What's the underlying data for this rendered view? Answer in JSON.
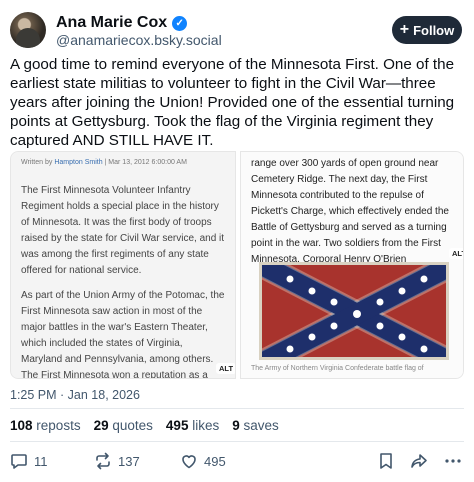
{
  "author": {
    "display_name": "Ana Marie Cox",
    "handle": "@anamariecox.bsky.social",
    "verified_glyph": "✓"
  },
  "follow_button": {
    "label": "Follow",
    "icon": "+"
  },
  "post": {
    "text": "A good time to remind everyone of the Minnesota First. One of the earliest state militias to volunteer to fight in the Civil War—three years after joining the Union! Provided one of the essential turning points at Gettysburg. Took the flag of the Virginia regiment they captured AND STILL HAVE IT.",
    "timestamp": "1:25 PM · Jan 18, 2026"
  },
  "embed": {
    "left": {
      "byline_prefix": "Written by",
      "byline_author": "Hampton Smith",
      "byline_suffix": "| Mar 13, 2012 6:00:00 AM",
      "paragraph1": "The First Minnesota Volunteer Infantry Regiment holds a special place in the history of Minnesota. It was the first body of troops raised by the state for Civil War service, and it was among the first regiments of any state offered for national service.",
      "paragraph2": "As part of the Union Army of the Potomac, the First Minnesota saw action in most of the major battles in the war's Eastern Theater, which included the states of Virginia, Maryland and Pennsylvania, among others. The First Minnesota won a reputation as a",
      "alt_label": "ALT"
    },
    "right": {
      "text": "range over 300 yards of open ground near Cemetery Ridge. The next day, the First Minnesota contributed to the repulse of Pickett's Charge, which effectively ended the Battle of Gettysburg and served as a turning point in the war. Two soldiers from the First Minnesota, Corporal Henry O'Brien",
      "caption": "The Army of Northern Virginia Confederate battle flag of",
      "alt_label": "ALT",
      "flag_colors": {
        "field": "#a8332d",
        "cross": "#1e2f6b",
        "border": "#d9d2c2",
        "stars": "#ffffff"
      }
    }
  },
  "stats": {
    "reposts_count": "108",
    "reposts_label": "reposts",
    "quotes_count": "29",
    "quotes_label": "quotes",
    "likes_count": "495",
    "likes_label": "likes",
    "saves_count": "9",
    "saves_label": "saves"
  },
  "actions": {
    "reply_count": "11",
    "repost_count": "137",
    "like_count": "495"
  },
  "colors": {
    "accent": "#1083fe",
    "follow_bg": "#1f2a38",
    "muted": "#42576c"
  }
}
